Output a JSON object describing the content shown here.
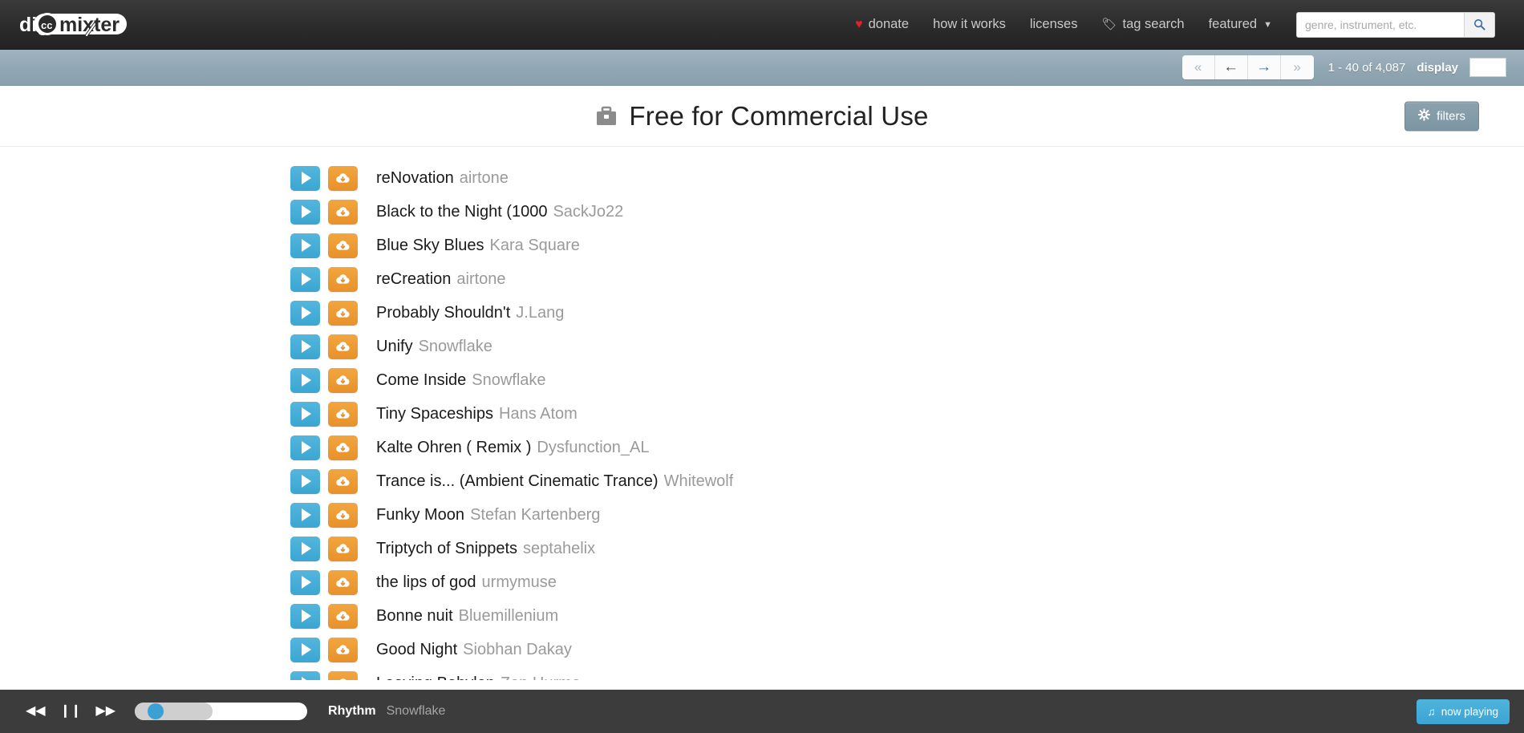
{
  "brand": {
    "text_part1": "dig",
    "badge": "cc",
    "text_part2": "mixter"
  },
  "nav": {
    "items": [
      {
        "label": "donate",
        "icon": "heart-icon"
      },
      {
        "label": "how it works",
        "icon": null
      },
      {
        "label": "licenses",
        "icon": null
      },
      {
        "label": "tag search",
        "icon": "tag-icon"
      },
      {
        "label": "featured",
        "icon": "chevron-down-icon"
      }
    ]
  },
  "search": {
    "placeholder": "genre, instrument, etc.",
    "value": "",
    "icon": "search-icon"
  },
  "toolbar": {
    "pager": [
      {
        "name": "first-page",
        "glyph": "«",
        "state": "disabled"
      },
      {
        "name": "prev-page",
        "glyph": "←",
        "state": "enabled"
      },
      {
        "name": "next-page",
        "glyph": "→",
        "state": "active"
      },
      {
        "name": "last-page",
        "glyph": "»",
        "state": "disabled"
      }
    ],
    "count_text": "1 - 40 of 4,087",
    "display_label": "display",
    "display_value": ""
  },
  "header": {
    "title": "Free for Commercial Use",
    "title_icon": "briefcase-icon",
    "filters_label": "filters",
    "filters_icon": "gear-icon"
  },
  "tracks": [
    {
      "title": "reNovation",
      "artist": "airtone"
    },
    {
      "title": "Black to the Night (1000",
      "artist": "SackJo22"
    },
    {
      "title": "Blue Sky Blues",
      "artist": "Kara Square"
    },
    {
      "title": "reCreation",
      "artist": "airtone"
    },
    {
      "title": "Probably Shouldn't",
      "artist": "J.Lang"
    },
    {
      "title": "Unify",
      "artist": "Snowflake"
    },
    {
      "title": "Come Inside",
      "artist": "Snowflake"
    },
    {
      "title": "Tiny Spaceships",
      "artist": "Hans Atom"
    },
    {
      "title": "Kalte Ohren ( Remix )",
      "artist": "Dysfunction_AL"
    },
    {
      "title": "Trance is... (Ambient Cinematic Trance)",
      "artist": "Whitewolf"
    },
    {
      "title": "Funky Moon",
      "artist": "Stefan Kartenberg"
    },
    {
      "title": "Triptych of Snippets",
      "artist": "septahelix"
    },
    {
      "title": "the lips of god",
      "artist": "urmymuse"
    },
    {
      "title": "Bonne nuit",
      "artist": "Bluemillenium"
    },
    {
      "title": "Good Night",
      "artist": "Siobhan Dakay"
    },
    {
      "title": "Leaving Babylon",
      "artist": "Zep Hurme"
    }
  ],
  "player": {
    "prev_glyph": "◀◀",
    "pause_glyph": "❙❙",
    "next_glyph": "▶▶",
    "progress_percent": 8,
    "buffer_percent": 45,
    "now_title": "Rhythm",
    "now_artist": "Snowflake",
    "now_playing_label": "now playing",
    "now_playing_icon": "music-note-icon"
  },
  "colors": {
    "play_blue": "#3aa6d2",
    "download_orange": "#e8912a",
    "toolbar_slate": "#92a8b4",
    "donate_red": "#e0202a",
    "player_bg": "#3c3c3c"
  }
}
